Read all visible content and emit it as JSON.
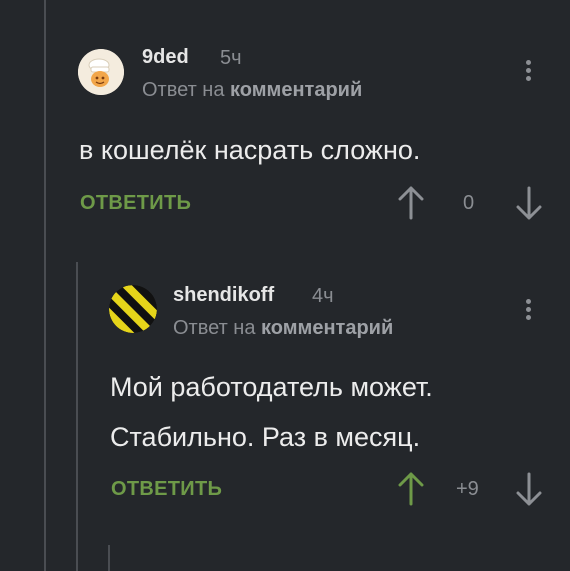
{
  "comments": [
    {
      "username": "9ded",
      "time": "5ч",
      "reply_prefix": "Ответ на",
      "reply_target": "комментарий",
      "text": "в кошелёк насрать сложно.",
      "reply_label": "ОТВЕТИТЬ",
      "score": "0"
    },
    {
      "username": "shendikoff",
      "time": "4ч",
      "reply_prefix": "Ответ на",
      "reply_target": "комментарий",
      "text_line1": "Мой работодатель может.",
      "text_line2": "Стабильно. Раз в месяц.",
      "reply_label": "ОТВЕТИТЬ",
      "score": "+9"
    }
  ],
  "colors": {
    "background": "#24272b",
    "accent_green": "#6e9a48",
    "muted": "#8a8d92",
    "thread_line": "#4a4d52"
  },
  "icons": [
    "more-vertical-icon",
    "arrow-up-icon",
    "arrow-down-icon",
    "avatar-icon"
  ]
}
